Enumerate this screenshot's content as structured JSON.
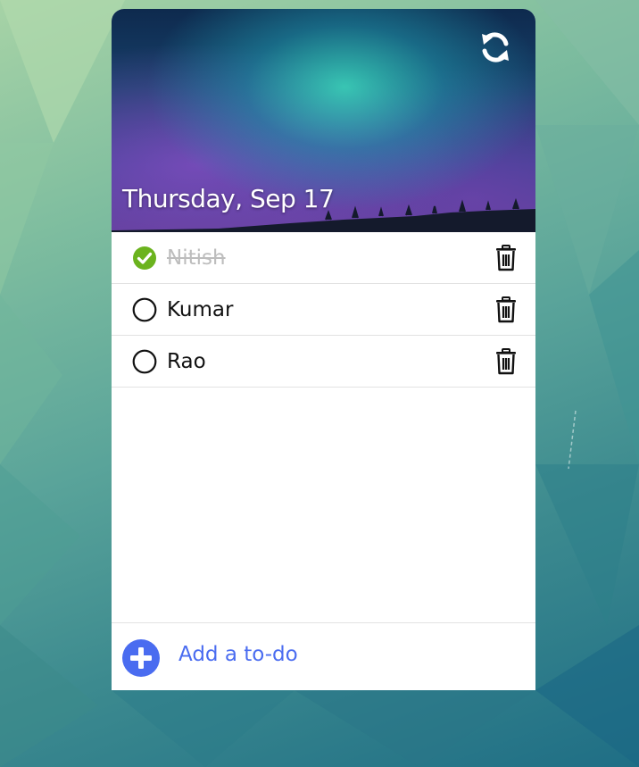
{
  "header": {
    "date": "Thursday, Sep 17"
  },
  "todos": [
    {
      "label": "Nitish",
      "done": true
    },
    {
      "label": "Kumar",
      "done": false
    },
    {
      "label": "Rao",
      "done": false
    }
  ],
  "footer": {
    "add_label": "Add a to-do"
  },
  "colors": {
    "accent": "#4a6cf0",
    "done_check": "#6bb31e",
    "done_text": "#bdbdbd"
  },
  "icons": {
    "refresh": "refresh-icon",
    "check_done": "check-circle-icon",
    "check_empty": "circle-icon",
    "trash": "trash-icon",
    "add": "plus-circle-icon"
  }
}
